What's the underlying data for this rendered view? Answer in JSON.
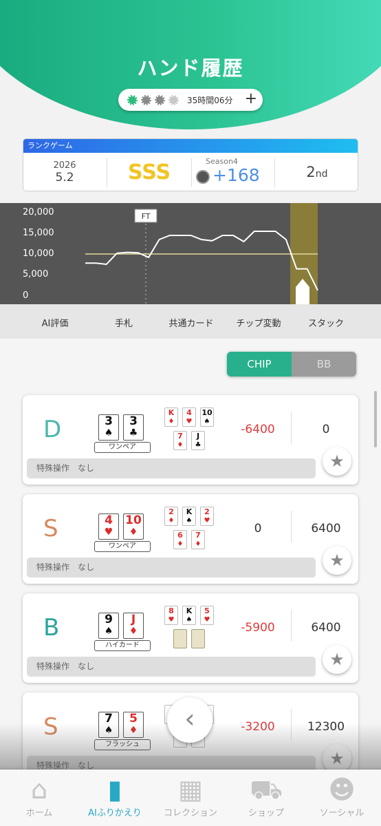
{
  "header": {
    "title": "ハンド履歴",
    "time": "35時間06分",
    "chip_colors": [
      "#2dbd7d",
      "#8a8a8a",
      "#8a8a8a",
      "#c8c8c8"
    ]
  },
  "rank": {
    "label": "ランクゲーム",
    "year": "2026",
    "date": "5.2",
    "grade": "SSS",
    "season": "Season4",
    "points": "+168",
    "place": "2",
    "place_suffix": "nd"
  },
  "chart_data": {
    "type": "line",
    "y_ticks": [
      "20,000",
      "15,000",
      "10,000",
      "5,000",
      "0"
    ],
    "ylim": [
      0,
      20000
    ],
    "marker": "FT",
    "values": [
      7800,
      7800,
      7500,
      10200,
      10400,
      10300,
      9200,
      13500,
      14500,
      14500,
      14500,
      13500,
      13200,
      14500,
      14500,
      13000,
      15500,
      15500,
      15500,
      13500,
      6400,
      6400,
      1200
    ],
    "reference_value": 10000
  },
  "tabs": [
    "AI評価",
    "手札",
    "共通カード",
    "チップ変動",
    "スタック"
  ],
  "toggle": {
    "chip": "CHIP",
    "bb": "BB"
  },
  "hands": [
    {
      "pos": "D",
      "pos_color": "#4ab8ac",
      "hole": [
        [
          "3",
          "♠",
          "#111"
        ],
        [
          "3",
          "♣",
          "#111"
        ]
      ],
      "hand_label": "ワンペア",
      "board": [
        [
          "K",
          "♦",
          "#e02b2b"
        ],
        [
          "4",
          "♥",
          "#e02b2b"
        ],
        [
          "10",
          "♠",
          "#111"
        ],
        [
          "7",
          "♦",
          "#e02b2b"
        ],
        [
          "J",
          "♣",
          "#111"
        ]
      ],
      "chip_change": "-6400",
      "chip_color": "#e03a3a",
      "stack": "0",
      "special_label": "特殊操作",
      "special_value": "なし"
    },
    {
      "pos": "S",
      "pos_color": "#d68a5e",
      "hole": [
        [
          "4",
          "♥",
          "#e02b2b"
        ],
        [
          "10",
          "♦",
          "#e02b2b"
        ]
      ],
      "hand_label": "ワンペア",
      "board": [
        [
          "2",
          "♦",
          "#e02b2b"
        ],
        [
          "K",
          "♠",
          "#111"
        ],
        [
          "2",
          "♥",
          "#e02b2b"
        ],
        [
          "6",
          "♦",
          "#e02b2b"
        ],
        [
          "7",
          "♦",
          "#e02b2b"
        ]
      ],
      "chip_change": "0",
      "chip_color": "#333",
      "stack": "6400",
      "special_label": "特殊操作",
      "special_value": "なし"
    },
    {
      "pos": "B",
      "pos_color": "#2aa5a0",
      "hole": [
        [
          "9",
          "♠",
          "#111"
        ],
        [
          "J",
          "♦",
          "#e02b2b"
        ]
      ],
      "hand_label": "ハイカード",
      "board": [
        [
          "8",
          "♥",
          "#e02b2b"
        ],
        [
          "K",
          "♠",
          "#111"
        ],
        [
          "5",
          "♥",
          "#e02b2b"
        ],
        [
          "",
          "",
          "back"
        ],
        [
          "",
          "",
          "back"
        ]
      ],
      "chip_change": "-5900",
      "chip_color": "#e03a3a",
      "stack": "6400",
      "special_label": "特殊操作",
      "special_value": "なし"
    },
    {
      "pos": "S",
      "pos_color": "#d68a5e",
      "hole": [
        [
          "7",
          "♠",
          "#111"
        ],
        [
          "5",
          "♦",
          "#e02b2b"
        ]
      ],
      "hand_label": "フラッシュ",
      "board": [
        [
          "",
          "",
          "#111"
        ],
        [
          "",
          "",
          "#111"
        ],
        [
          "",
          "",
          "#111"
        ],
        [
          "",
          "♦",
          "#e02b2b"
        ],
        [
          "",
          "♦",
          "#e02b2b"
        ]
      ],
      "chip_change": "-3200",
      "chip_color": "#e03a3a",
      "stack": "12300",
      "special_label": "特殊操作",
      "special_value": "なし"
    }
  ],
  "nav": [
    {
      "label": "ホーム",
      "icon": "home-icon",
      "glyph": "⌂",
      "active": false
    },
    {
      "label": "AIふりかえり",
      "icon": "bar-chart-icon",
      "glyph": "▮",
      "active": true
    },
    {
      "label": "コレクション",
      "icon": "collection-icon",
      "glyph": "▦",
      "active": false
    },
    {
      "label": "ショップ",
      "icon": "cart-icon",
      "glyph": "⛟",
      "active": false
    },
    {
      "label": "ソーシャル",
      "icon": "social-icon",
      "glyph": "☻",
      "active": false
    }
  ]
}
